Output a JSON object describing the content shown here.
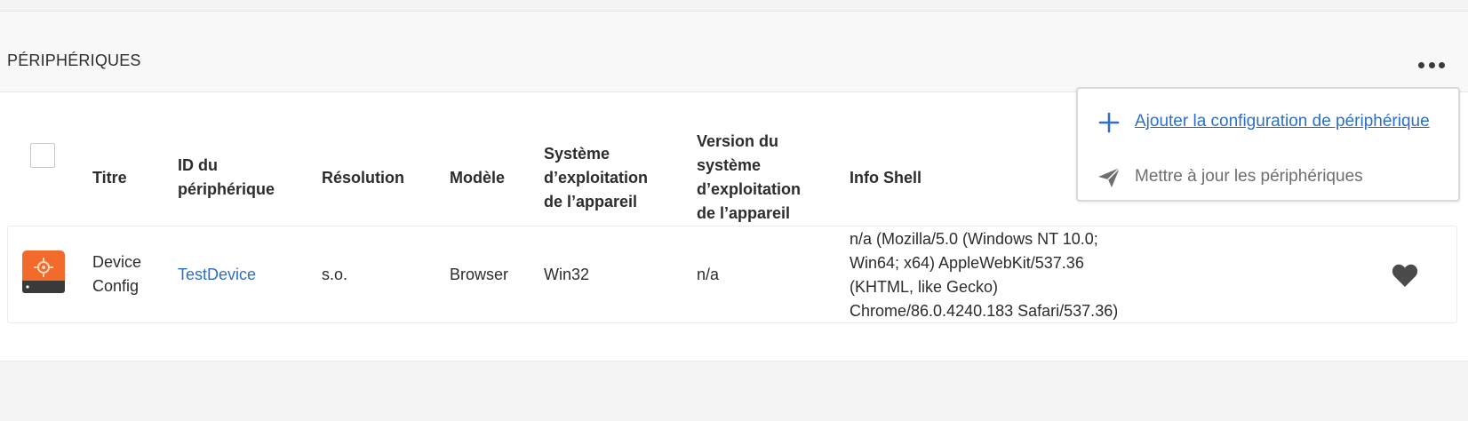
{
  "header": {
    "title": "PÉRIPHÉRIQUES"
  },
  "table": {
    "columns": {
      "title": "Titre",
      "device_id": [
        "ID du",
        "périphérique"
      ],
      "resolution": "Résolution",
      "model": "Modèle",
      "os": [
        "Système",
        "d’exploitation",
        "de l’appareil"
      ],
      "os_version": [
        "Version du",
        "système",
        "d’exploitation",
        "de l’appareil"
      ],
      "shell_info": "Info Shell"
    },
    "rows": [
      {
        "title": [
          "Device",
          "Config"
        ],
        "device_id": "TestDevice",
        "resolution": "s.o.",
        "model": "Browser",
        "os": "Win32",
        "os_version": "n/a",
        "shell_info": [
          "n/a (Mozilla/5.0 (Windows NT 10.0;",
          "Win64; x64) AppleWebKit/537.36",
          "(KHTML, like Gecko)",
          "Chrome/86.0.4240.183 Safari/537.36)"
        ],
        "favorite_icon": "heart-icon"
      }
    ]
  },
  "menu": {
    "items": [
      {
        "label": "Ajouter la configuration de périphérique",
        "icon": "plus-icon"
      },
      {
        "label": "Mettre à jour les périphériques",
        "icon": "send-icon"
      }
    ]
  },
  "colors": {
    "accent": "#2d6fc4",
    "thumbnail": "#f26b2a"
  }
}
